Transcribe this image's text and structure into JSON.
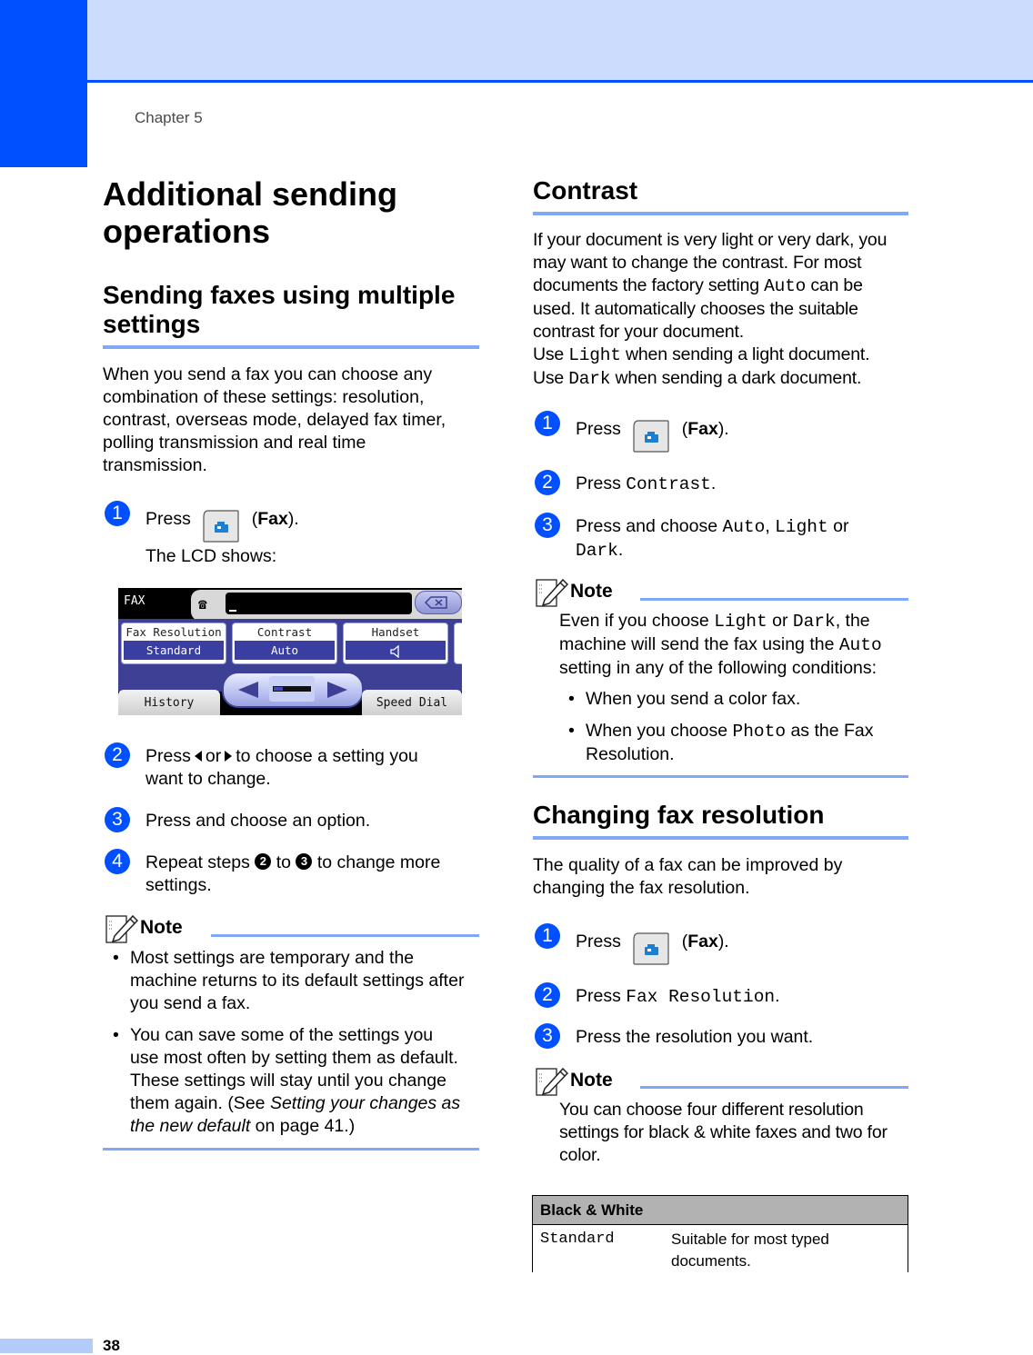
{
  "header": {
    "chapter": "Chapter 5"
  },
  "footer": {
    "page_number": "38"
  },
  "colors": {
    "brand_blue": "#0050ff",
    "band_light": "#ccdcfc",
    "rule_blue": "#80a8f6"
  },
  "left": {
    "title_line1": "Additional sending",
    "title_line2": "operations",
    "section_title_line1": "Sending faxes using multiple",
    "section_title_line2": "settings",
    "intro": [
      "When you send a fax you can choose any",
      "combination of these settings: resolution,",
      "contrast, overseas mode, delayed fax timer,",
      "polling transmission and real time",
      "transmission."
    ],
    "step1": {
      "num": "1",
      "press": "Press",
      "fax": "Fax",
      "sub": "The LCD shows:"
    },
    "lcd": {
      "title": "FAX",
      "settings": [
        {
          "label": "Fax Resolution",
          "value": "Standard"
        },
        {
          "label": "Contrast",
          "value": "Auto"
        },
        {
          "label": "Handset",
          "value": "speaker-icon"
        }
      ],
      "history": "History",
      "speed_dial": "Speed Dial"
    },
    "step2": {
      "num": "2",
      "line1a": "Press",
      "line1b": "or",
      "line1c": "to choose a setting you",
      "line2": "want to change."
    },
    "step3": {
      "num": "3",
      "text": "Press and choose an option."
    },
    "step4": {
      "num": "4",
      "a": "Repeat steps",
      "ref1": "2",
      "b": "to",
      "ref2": "3",
      "c": "to change more",
      "line2": "settings."
    },
    "note": {
      "label": "Note",
      "bullets": [
        [
          "Most settings are temporary and the",
          "machine returns to its default settings after",
          "you send a fax."
        ],
        [
          "You can save some of the settings you",
          "use most often by setting them as default.",
          "These settings will stay until you change"
        ]
      ],
      "last_line_a": "them again. (See ",
      "last_line_italic": "Setting your changes as",
      "last_line2_italic": "the new default",
      "last_line2_b": " on page 41.)"
    }
  },
  "right": {
    "contrast": {
      "title": "Contrast",
      "p1": "If your document is very light or very dark, you",
      "p2": "may want to change the contrast. For most",
      "p3a": "documents the factory setting ",
      "p3code": "Auto",
      "p3b": " can be",
      "p4": "used. It automatically chooses the suitable",
      "p5": "contrast for your document.",
      "p6a": "Use ",
      "p6code": "Light",
      "p6b": " when sending a light document.",
      "p7a": "Use ",
      "p7code": "Dark",
      "p7b": " when sending a dark document.",
      "step1": {
        "num": "1",
        "press": "Press",
        "fax": "Fax"
      },
      "step2": {
        "num": "2",
        "press": "Press ",
        "code": "Contrast",
        "end": "."
      },
      "step3": {
        "num": "3",
        "a": "Press and choose ",
        "c1": "Auto",
        "sep": ", ",
        "c2": "Light",
        "or": " or",
        "c3": "Dark",
        "end": "."
      },
      "note": {
        "label": "Note",
        "l1a": "Even if you choose ",
        "l1c1": "Light",
        "l1b": " or ",
        "l1c2": "Dark",
        "l1d": ", the",
        "l2a": "machine will send the fax using the ",
        "l2c": "Auto",
        "l3": "setting in any of the following conditions:",
        "b1": "When you send a color fax.",
        "b2a": "When you choose ",
        "b2c": "Photo",
        "b2b": " as the Fax",
        "b2l2": "Resolution."
      }
    },
    "resolution": {
      "title": "Changing fax resolution",
      "p1": "The quality of a fax can be improved by",
      "p2": "changing the fax resolution.",
      "step1": {
        "num": "1",
        "press": "Press",
        "fax": "Fax"
      },
      "step2": {
        "num": "2",
        "press": "Press ",
        "code": "Fax Resolution",
        "end": "."
      },
      "step3": {
        "num": "3",
        "text": "Press the resolution you want."
      },
      "note": {
        "label": "Note",
        "l1": "You can choose four different resolution",
        "l2": "settings for black & white faxes and two for",
        "l3": "color."
      },
      "table": {
        "header": "Black & White",
        "rows": [
          {
            "setting": "Standard",
            "desc_l1": "Suitable for most typed",
            "desc_l2": "documents."
          }
        ]
      }
    }
  }
}
